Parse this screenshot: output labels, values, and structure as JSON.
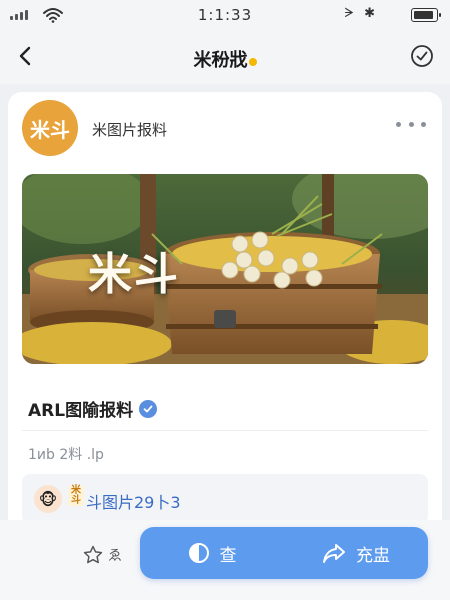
{
  "status_bar": {
    "time": "1:1:33",
    "right_text": "ᗒ ✱"
  },
  "nav": {
    "title": "米秎戕"
  },
  "post": {
    "avatar_text": "米斗",
    "author": "米图片报料",
    "image_caption": "米斗",
    "title": "ARL图隃报料",
    "meta": "1иb 2料 .lp",
    "related_badge": "米斗",
    "related_text": "斗图片29卜3"
  },
  "bottom_bar": {
    "star_label": "ゑ",
    "view_label": "查",
    "share_label": "充盅"
  },
  "colors": {
    "accent": "#5d9bef",
    "avatar": "#e8a33a",
    "link": "#3a6cc4"
  },
  "icons": [
    "back-arrow-icon",
    "check-circle-icon",
    "more-dots-icon",
    "verified-icon",
    "star-icon",
    "view-icon",
    "share-icon"
  ]
}
